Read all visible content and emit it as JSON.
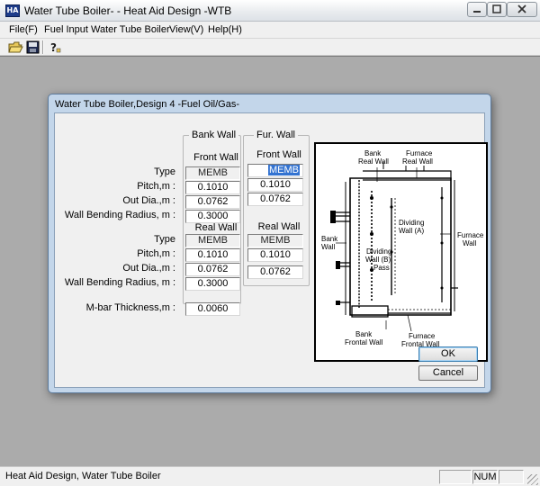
{
  "window": {
    "title": "Water Tube Boiler- - Heat Aid Design -WTB"
  },
  "menu": [
    "File(F)",
    "Fuel Input",
    "Water Tube Boiler",
    "View(V)",
    "Help(H)"
  ],
  "toolbar": {
    "icons": [
      "open-folder-icon",
      "save-disk-icon",
      "help-icon"
    ]
  },
  "dialog": {
    "title": "Water Tube Boiler,Design 4  -Fuel Oil/Gas-",
    "bank_wall": {
      "group_label": "Bank Wall",
      "front_header": "Front Wall",
      "front": {
        "type": "MEMB",
        "pitch": "0.1010",
        "out_dia": "0.0762",
        "radius": "0.3000"
      },
      "real_header": "Real Wall",
      "real": {
        "type": "MEMB",
        "pitch": "0.1010",
        "out_dia": "0.0762",
        "radius": "0.3000"
      }
    },
    "fur_wall": {
      "group_label": "Fur.  Wall",
      "front_header": "Front Wall",
      "front": {
        "type": "MEMB",
        "pitch": "0.1010",
        "out_dia": "0.0762"
      },
      "real_header": "Real Wall",
      "real": {
        "type": "MEMB",
        "pitch": "0.1010",
        "out_dia": "0.0762"
      }
    },
    "labels": {
      "type": "Type",
      "pitch": "Pitch,m :",
      "out_dia": "Out Dia.,m :",
      "radius": "Wall Bending Radius, m :",
      "radius2": "Wall Bending Radius, m :",
      "mbar": "M-bar Thickness,m :"
    },
    "mbar_value": "0.0060",
    "diagram_labels": {
      "bank_real_1": "Bank",
      "bank_real_2": "Real Wall",
      "fur_real_1": "Furnace",
      "fur_real_2": "Real Wall",
      "div_a_1": "Dividing",
      "div_a_2": "Wall (A)",
      "bank_wall_1": "Bank",
      "bank_wall_2": "Wall",
      "div_b_1": "Dividing",
      "div_b_2": "Wall (B)",
      "div_b_3": "Pass",
      "fur_wall_1": "Furnace",
      "fur_wall_2": "Wall",
      "bank_front_1": "Bank",
      "bank_front_2": "Frontal Wall",
      "fur_front_1": "Furnace",
      "fur_front_2": "Frontal Wall"
    },
    "ok_label": "OK",
    "cancel_label": "Cancel"
  },
  "status": {
    "text": "Heat Aid Design, Water Tube Boiler",
    "num": "NUM"
  }
}
